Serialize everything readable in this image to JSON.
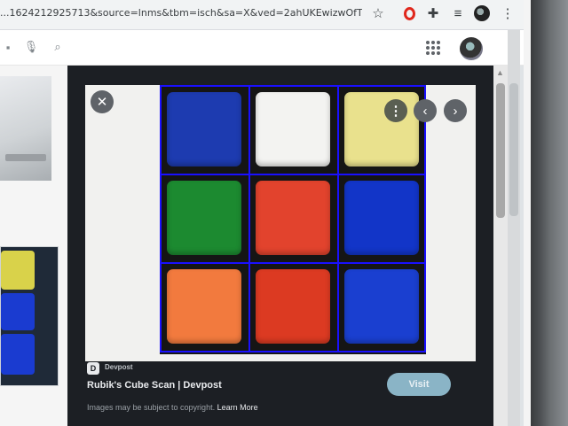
{
  "browser": {
    "url": "...1624212925713&source=lnms&tbm=isch&sa=X&ved=2ahUKEwizwOfT...",
    "icons": [
      "bookmark-star-icon",
      "opera-icon",
      "extensions-puzzle-icon",
      "reading-list-icon",
      "profile-icon",
      "kebab-menu-icon"
    ]
  },
  "toolbar": {
    "icons": [
      "mic-icon",
      "search-icon",
      "apps-grid-icon",
      "account-avatar-icon"
    ]
  },
  "viewer": {
    "buttons": {
      "close": "✕",
      "more": "⋮",
      "prev": "‹",
      "next": "›"
    },
    "cube": {
      "rows": [
        [
          "#1d3bb0",
          "#f3f3f1",
          "#e9e18d"
        ],
        [
          "#1c8a30",
          "#e2432d",
          "#1235c8"
        ],
        [
          "#f27a3e",
          "#dc3a22",
          "#1a3fd0"
        ]
      ],
      "overlay_color": "#1a10ff"
    },
    "source_logo": "D",
    "source": "Devpost",
    "title": "Rubik's Cube Scan | Devpost",
    "visit_label": "Visit",
    "copyright": "Images may be subject to copyright.",
    "learn_more": "Learn More"
  },
  "left_results": {
    "bottom_thumbnail_colors": [
      "#d9d24a",
      "#1a3bd0",
      "#1a3bd0"
    ]
  },
  "colors": {
    "viewer_background": "#1c1f24",
    "visit_button": "#8ab4c6",
    "overlay_grid": "#1a10ff"
  }
}
